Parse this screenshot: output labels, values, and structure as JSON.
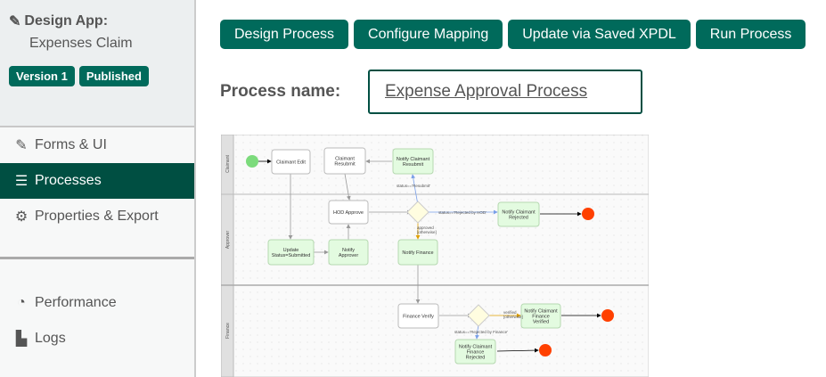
{
  "sidebar": {
    "app_label": "Design App:",
    "app_name": "Expenses Claim",
    "badges": [
      "Version 1",
      "Published"
    ],
    "items": [
      {
        "label": "Forms & UI",
        "icon": "edit-icon"
      },
      {
        "label": "Processes",
        "icon": "list-icon",
        "active": true
      },
      {
        "label": "Properties & Export",
        "icon": "gear-icon"
      },
      {
        "label": "Performance",
        "icon": "gauge-icon"
      },
      {
        "label": "Logs",
        "icon": "scroll-icon"
      }
    ]
  },
  "toolbar": {
    "buttons": [
      "Design Process",
      "Configure Mapping",
      "Update via Saved XPDL",
      "Run Process"
    ]
  },
  "process": {
    "name_label": "Process name:",
    "name": "Expense Approval Process"
  },
  "colors": {
    "brand": "#006a5b",
    "active": "#004f42",
    "task_green": "#e3fbe0",
    "end": "#ff4000",
    "start": "#7cdb7c"
  },
  "diagram": {
    "lanes": [
      "Claimant",
      "Approver",
      "Finance"
    ],
    "nodes": {
      "claimant_edit": "Claimant Edit",
      "claimant_resubmit": [
        "Claimant",
        "Resubmit"
      ],
      "notify_resubmit": [
        "Notify Claimant",
        "Resubmit"
      ],
      "hod_approve": "HOD Approve",
      "notify_rejected": [
        "Notify Claimant",
        "Rejected"
      ],
      "update_status": [
        "Update",
        "Status=Submitted"
      ],
      "notify_approver": [
        "Notify",
        "Approver"
      ],
      "notify_finance": "Notify Finance",
      "finance_verify": "Finance Verify",
      "notify_fin_verified": [
        "Notify Claimant",
        "Finance",
        "Verified"
      ],
      "notify_fin_rejected": [
        "Notify Claimant",
        "Finance",
        "Rejected"
      ]
    },
    "labels": {
      "resubmit": "status=='Resubmit'",
      "rejected_hod": "status=='Rejected by HOD'",
      "approved": [
        "approved",
        "[otherwise]"
      ],
      "verified": [
        "verified",
        "[otherwise]"
      ],
      "rejected_fin": "status=='Rejected by Finance'"
    }
  }
}
